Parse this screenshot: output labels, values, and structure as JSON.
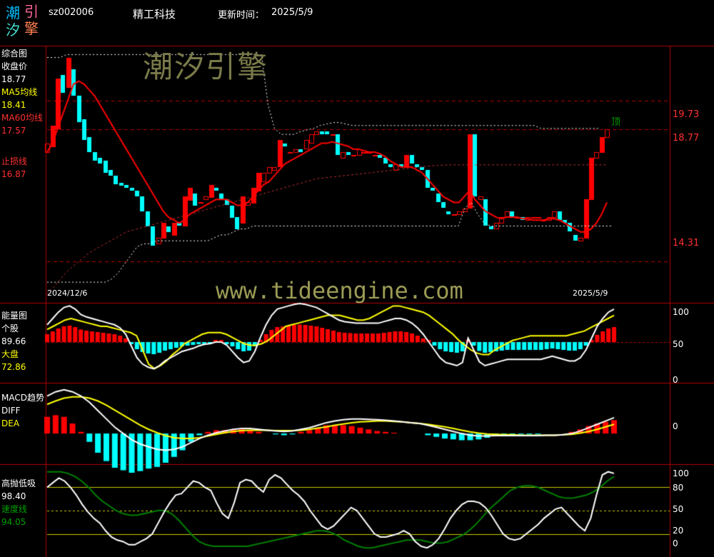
{
  "header": {
    "logo_chars": [
      "潮",
      "引",
      "汐",
      "擎"
    ],
    "code": "sz002006",
    "name": "精工科技",
    "update_label": "更新时间：",
    "update_date": "2025/5/9"
  },
  "watermark": {
    "cn": "潮汐引擎",
    "url": "www.tideengine.com"
  },
  "colors": {
    "red": "#ff0000",
    "cyan": "#00ffff",
    "yellow": "#ffff00",
    "green": "#008000",
    "white": "#ffffff",
    "grid_red": "#b00000"
  },
  "panels": {
    "main": {
      "title": "综合图",
      "close_label": "收盘价",
      "close_value": "18.77",
      "ma5_label": "MA5均线",
      "ma5_value": "18.41",
      "ma60_label": "MA60均线",
      "ma60_value": "17.57",
      "stop_label": "止损线",
      "stop_value": "16.87",
      "right_labels": [
        "19.73",
        "18.77",
        "14.31"
      ],
      "top_marker": "顶",
      "date_start": "2024/12/6",
      "date_end": "2025/5/9"
    },
    "energy": {
      "title": "能量图",
      "stock_label": "个股",
      "stock_value": "89.66",
      "market_label": "大盘",
      "market_value": "72.86",
      "right_labels": [
        "100",
        "50",
        "0"
      ]
    },
    "macd": {
      "title": "MACD趋势",
      "diff_label": "DIFF",
      "dea_label": "DEA",
      "right_labels": [
        "0"
      ]
    },
    "hl": {
      "title": "高抛低吸",
      "value": "98.40",
      "speed_label": "速度线",
      "speed_value": "94.05",
      "right_labels": [
        "100",
        "80",
        "50",
        "20",
        "0"
      ]
    }
  },
  "chart_data": {
    "type": "candlestick",
    "x_range": [
      "2024/12/6",
      "2025/5/9"
    ],
    "price_axis_marks": [
      19.73,
      18.77,
      14.31
    ],
    "candles": [
      {
        "o": 18.0,
        "c": 18.3
      },
      {
        "o": 18.2,
        "c": 18.9
      },
      {
        "o": 18.8,
        "c": 20.5
      },
      {
        "o": 20.6,
        "c": 20.0
      },
      {
        "o": 20.2,
        "c": 21.2
      },
      {
        "o": 20.8,
        "c": 19.9
      },
      {
        "o": 19.9,
        "c": 19.0
      },
      {
        "o": 19.1,
        "c": 18.4
      },
      {
        "o": 18.5,
        "c": 18.0
      },
      {
        "o": 18.0,
        "c": 17.7
      },
      {
        "o": 17.8,
        "c": 17.6
      },
      {
        "o": 17.7,
        "c": 17.3
      },
      {
        "o": 17.4,
        "c": 17.2
      },
      {
        "o": 17.2,
        "c": 16.9
      },
      {
        "o": 16.95,
        "c": 16.85
      },
      {
        "o": 16.9,
        "c": 16.8
      },
      {
        "o": 16.8,
        "c": 16.7
      },
      {
        "o": 16.7,
        "c": 16.5
      },
      {
        "o": 16.5,
        "c": 16.0
      },
      {
        "o": 16.0,
        "c": 15.5
      },
      {
        "o": 15.5,
        "c": 14.85
      },
      {
        "o": 14.9,
        "c": 15.1
      },
      {
        "o": 15.1,
        "c": 15.6
      },
      {
        "o": 15.5,
        "c": 15.3
      },
      {
        "o": 15.2,
        "c": 15.6
      },
      {
        "o": 15.6,
        "c": 15.5
      },
      {
        "o": 15.5,
        "c": 16.5
      },
      {
        "o": 16.4,
        "c": 16.8
      },
      {
        "o": 16.6,
        "c": 16.2
      },
      {
        "o": 16.3,
        "c": 16.3
      },
      {
        "o": 16.4,
        "c": 16.5
      },
      {
        "o": 16.5,
        "c": 16.9
      },
      {
        "o": 16.8,
        "c": 16.7
      },
      {
        "o": 16.6,
        "c": 16.4
      },
      {
        "o": 16.4,
        "c": 16.2
      },
      {
        "o": 16.2,
        "c": 15.8
      },
      {
        "o": 15.8,
        "c": 15.4
      },
      {
        "o": 15.6,
        "c": 16.5
      },
      {
        "o": 16.2,
        "c": 16.3
      },
      {
        "o": 16.3,
        "c": 16.8
      },
      {
        "o": 16.7,
        "c": 17.3
      },
      {
        "o": 17.0,
        "c": 17.3
      },
      {
        "o": 17.3,
        "c": 17.5
      },
      {
        "o": 17.4,
        "c": 17.5
      },
      {
        "o": 17.5,
        "c": 18.4
      },
      {
        "o": 18.3,
        "c": 18.2
      },
      {
        "o": 18.0,
        "c": 18.0
      },
      {
        "o": 18.0,
        "c": 18.1
      },
      {
        "o": 18.1,
        "c": 18.0
      },
      {
        "o": 18.1,
        "c": 18.4
      },
      {
        "o": 18.3,
        "c": 18.6
      },
      {
        "o": 18.6,
        "c": 18.7
      },
      {
        "o": 18.7,
        "c": 18.6
      },
      {
        "o": 18.7,
        "c": 18.6
      },
      {
        "o": 18.6,
        "c": 18.6
      },
      {
        "o": 18.6,
        "c": 17.9
      },
      {
        "o": 17.8,
        "c": 18.0
      },
      {
        "o": 18.0,
        "c": 17.9
      },
      {
        "o": 17.9,
        "c": 17.9
      },
      {
        "o": 17.9,
        "c": 18.1
      },
      {
        "o": 18.0,
        "c": 18.0
      },
      {
        "o": 18.0,
        "c": 18.0
      },
      {
        "o": 17.9,
        "c": 17.9
      },
      {
        "o": 17.9,
        "c": 17.8
      },
      {
        "o": 17.8,
        "c": 17.6
      },
      {
        "o": 17.6,
        "c": 17.5
      },
      {
        "o": 17.4,
        "c": 17.6
      },
      {
        "o": 17.6,
        "c": 17.5
      },
      {
        "o": 17.5,
        "c": 17.9
      },
      {
        "o": 17.9,
        "c": 17.6
      },
      {
        "o": 17.6,
        "c": 17.5
      },
      {
        "o": 17.5,
        "c": 17.4
      },
      {
        "o": 17.4,
        "c": 16.8
      },
      {
        "o": 16.8,
        "c": 16.7
      },
      {
        "o": 16.6,
        "c": 16.3
      },
      {
        "o": 16.3,
        "c": 16.1
      },
      {
        "o": 16.0,
        "c": 15.9
      },
      {
        "o": 15.9,
        "c": 15.9
      },
      {
        "o": 15.9,
        "c": 16.0
      },
      {
        "o": 16.0,
        "c": 16.1
      },
      {
        "o": 16.1,
        "c": 18.6
      },
      {
        "o": 18.6,
        "c": 16.5
      },
      {
        "o": 16.4,
        "c": 16.5
      },
      {
        "o": 16.4,
        "c": 15.5
      },
      {
        "o": 15.5,
        "c": 15.4
      },
      {
        "o": 15.4,
        "c": 15.6
      },
      {
        "o": 15.6,
        "c": 15.8
      },
      {
        "o": 15.8,
        "c": 16.0
      },
      {
        "o": 16.0,
        "c": 15.8
      },
      {
        "o": 15.8,
        "c": 15.8
      },
      {
        "o": 15.8,
        "c": 15.7
      },
      {
        "o": 15.7,
        "c": 15.8
      },
      {
        "o": 15.8,
        "c": 15.8
      },
      {
        "o": 15.8,
        "c": 15.8
      },
      {
        "o": 15.7,
        "c": 15.7
      },
      {
        "o": 15.7,
        "c": 15.8
      },
      {
        "o": 15.8,
        "c": 16.0
      },
      {
        "o": 16.0,
        "c": 15.7
      },
      {
        "o": 15.7,
        "c": 15.6
      },
      {
        "o": 15.6,
        "c": 15.3
      },
      {
        "o": 15.2,
        "c": 15.0
      },
      {
        "o": 15.0,
        "c": 15.1
      },
      {
        "o": 15.1,
        "c": 16.4
      },
      {
        "o": 16.4,
        "c": 17.8
      },
      {
        "o": 17.8,
        "c": 18.0
      },
      {
        "o": 18.0,
        "c": 18.5
      },
      {
        "o": 18.5,
        "c": 18.77
      }
    ],
    "ma5": [
      18.0,
      18.3,
      18.8,
      19.3,
      19.8,
      20.3,
      20.4,
      20.3,
      20.1,
      19.9,
      19.6,
      19.3,
      19.0,
      18.7,
      18.4,
      18.1,
      17.8,
      17.5,
      17.2,
      16.9,
      16.6,
      16.3,
      16.0,
      15.8,
      15.7,
      15.6,
      15.7,
      15.9,
      16.0,
      16.1,
      16.2,
      16.3,
      16.4,
      16.4,
      16.4,
      16.3,
      16.2,
      16.2,
      16.3,
      16.5,
      16.7,
      16.9,
      17.0,
      17.2,
      17.4,
      17.6,
      17.7,
      17.8,
      17.9,
      18.0,
      18.1,
      18.2,
      18.3,
      18.3,
      18.35,
      18.3,
      18.25,
      18.2,
      18.1,
      18.1,
      18.05,
      18.0,
      18.0,
      17.95,
      17.85,
      17.7,
      17.6,
      17.5,
      17.5,
      17.5,
      17.4,
      17.3,
      17.1,
      16.9,
      16.7,
      16.5,
      16.4,
      16.3,
      16.3,
      16.5,
      16.7,
      16.4,
      16.2,
      16.0,
      15.9,
      15.8,
      15.75,
      15.8,
      15.8,
      15.8,
      15.75,
      15.75,
      15.7,
      15.7,
      15.7,
      15.75,
      15.75,
      15.7,
      15.6,
      15.5,
      15.4,
      15.3,
      15.3,
      15.4,
      15.6,
      15.9,
      16.3
    ],
    "ma60": [
      13.2,
      13.4,
      13.6,
      13.8,
      14.0,
      14.15,
      14.3,
      14.45,
      14.6,
      14.7,
      14.8,
      14.9,
      15.0,
      15.1,
      15.2,
      15.3,
      15.35,
      15.4,
      15.45,
      15.5,
      15.55,
      15.6,
      15.65,
      15.7,
      15.75,
      15.8,
      15.85,
      15.9,
      15.95,
      16.0,
      16.05,
      16.1,
      16.15,
      16.2,
      16.25,
      16.3,
      16.35,
      16.4,
      16.45,
      16.5,
      16.55,
      16.6,
      16.65,
      16.7,
      16.75,
      16.8,
      16.85,
      16.9,
      16.95,
      17.0,
      17.05,
      17.1,
      17.12,
      17.14,
      17.16,
      17.18,
      17.2,
      17.22,
      17.24,
      17.26,
      17.28,
      17.3,
      17.32,
      17.34,
      17.36,
      17.38,
      17.4,
      17.42,
      17.44,
      17.46,
      17.48,
      17.5,
      17.52,
      17.54,
      17.55,
      17.56,
      17.57,
      17.57,
      17.57,
      17.57,
      17.57,
      17.57,
      17.57,
      17.57,
      17.57,
      17.57,
      17.57,
      17.57,
      17.57,
      17.57,
      17.57,
      17.57,
      17.57,
      17.57,
      17.57,
      17.57,
      17.57,
      17.57,
      17.57,
      17.57,
      17.57,
      17.57,
      17.57,
      17.57,
      17.57,
      17.57,
      17.57
    ],
    "energy_stock": [
      72,
      80,
      88,
      94,
      96,
      92,
      85,
      82,
      80,
      78,
      76,
      74,
      72,
      68,
      60,
      45,
      30,
      22,
      18,
      16,
      20,
      26,
      30,
      34,
      38,
      40,
      42,
      45,
      47,
      48,
      50,
      50,
      46,
      38,
      30,
      24,
      26,
      38,
      56,
      72,
      84,
      92,
      94,
      96,
      98,
      99,
      98,
      96,
      94,
      90,
      86,
      82,
      78,
      76,
      75,
      74,
      74,
      74,
      74,
      74,
      76,
      78,
      80,
      80,
      78,
      74,
      68,
      60,
      50,
      40,
      30,
      24,
      22,
      20,
      24,
      55,
      40,
      25,
      20,
      22,
      24,
      26,
      28,
      28,
      28,
      28,
      28,
      28,
      28,
      30,
      32,
      30,
      28,
      26,
      26,
      30,
      40,
      55,
      70,
      80,
      88,
      92
    ],
    "energy_market": [
      66,
      70,
      74,
      78,
      80,
      78,
      76,
      74,
      72,
      70,
      70,
      68,
      66,
      64,
      62,
      58,
      40,
      22,
      16,
      20,
      26,
      34,
      40,
      48,
      52,
      56,
      60,
      62,
      62,
      62,
      60,
      56,
      52,
      48,
      46,
      46,
      48,
      52,
      58,
      64,
      70,
      72,
      74,
      76,
      78,
      80,
      82,
      84,
      84,
      84,
      82,
      80,
      78,
      78,
      80,
      84,
      88,
      92,
      96,
      96,
      94,
      92,
      90,
      88,
      84,
      78,
      72,
      66,
      60,
      52,
      46,
      40,
      36,
      34,
      34,
      40,
      44,
      48,
      52,
      54,
      56,
      58,
      58,
      58,
      58,
      58,
      58,
      58,
      60,
      62,
      64,
      68,
      72,
      76,
      80,
      84
    ],
    "macd_diff": [
      0.9,
      1.0,
      1.05,
      1.0,
      0.9,
      0.75,
      0.55,
      0.35,
      0.15,
      0.0,
      -0.15,
      -0.25,
      -0.32,
      -0.38,
      -0.4,
      -0.38,
      -0.32,
      -0.22,
      -0.12,
      -0.04,
      0.02,
      0.06,
      0.1,
      0.12,
      0.12,
      0.1,
      0.08,
      0.06,
      0.05,
      0.06,
      0.1,
      0.14,
      0.2,
      0.26,
      0.3,
      0.33,
      0.35,
      0.35,
      0.34,
      0.33,
      0.32,
      0.3,
      0.28,
      0.26,
      0.24,
      0.2,
      0.15,
      0.1,
      0.05,
      0.0,
      -0.04,
      -0.06,
      -0.06,
      -0.05,
      -0.05,
      -0.05,
      -0.05,
      -0.05,
      -0.05,
      -0.04,
      -0.04,
      -0.03,
      0.0,
      0.06,
      0.14,
      0.22,
      0.3,
      0.38
    ],
    "macd_dea": [
      0.7,
      0.78,
      0.85,
      0.88,
      0.88,
      0.85,
      0.78,
      0.68,
      0.56,
      0.44,
      0.32,
      0.2,
      0.1,
      0.02,
      -0.05,
      -0.1,
      -0.12,
      -0.12,
      -0.1,
      -0.06,
      -0.02,
      0.02,
      0.05,
      0.07,
      0.08,
      0.08,
      0.08,
      0.07,
      0.07,
      0.07,
      0.08,
      0.1,
      0.13,
      0.16,
      0.2,
      0.23,
      0.26,
      0.28,
      0.29,
      0.3,
      0.3,
      0.29,
      0.28,
      0.26,
      0.24,
      0.22,
      0.19,
      0.16,
      0.12,
      0.08,
      0.04,
      0.01,
      -0.01,
      -0.02,
      -0.03,
      -0.03,
      -0.04,
      -0.04,
      -0.04,
      -0.04,
      -0.04,
      -0.03,
      -0.02,
      0.01,
      0.05,
      0.1,
      0.16,
      0.22
    ],
    "hl_value": [
      80,
      86,
      92,
      88,
      80,
      70,
      58,
      48,
      40,
      34,
      24,
      16,
      12,
      10,
      6,
      6,
      10,
      14,
      20,
      34,
      48,
      60,
      70,
      72,
      80,
      88,
      86,
      80,
      76,
      60,
      46,
      40,
      60,
      86,
      90,
      88,
      80,
      74,
      90,
      96,
      92,
      84,
      76,
      70,
      62,
      50,
      40,
      30,
      26,
      30,
      38,
      46,
      54,
      50,
      40,
      30,
      20,
      16,
      16,
      18,
      20,
      24,
      20,
      10,
      4,
      2,
      6,
      14,
      26,
      40,
      50,
      58,
      62,
      62,
      60,
      54,
      44,
      32,
      20,
      14,
      12,
      14,
      20,
      26,
      32,
      40,
      46,
      52,
      54,
      46,
      38,
      30,
      24,
      40,
      70,
      96,
      100,
      98
    ],
    "hl_speed": [
      100,
      100,
      100,
      98,
      94,
      88,
      80,
      70,
      62,
      56,
      50,
      46,
      44,
      44,
      46,
      48,
      50,
      50,
      46,
      38,
      28,
      18,
      10,
      6,
      4,
      4,
      4,
      4,
      4,
      4,
      6,
      8,
      10,
      12,
      14,
      16,
      18,
      20,
      22,
      24,
      24,
      22,
      18,
      12,
      8,
      4,
      2,
      2,
      4,
      6,
      8,
      10,
      12,
      12,
      12,
      10,
      8,
      8,
      10,
      14,
      18,
      24,
      32,
      42,
      52,
      60,
      68,
      76,
      80,
      82,
      82,
      80,
      76,
      72,
      68,
      66,
      66,
      68,
      70,
      74,
      80,
      88,
      94
    ]
  }
}
